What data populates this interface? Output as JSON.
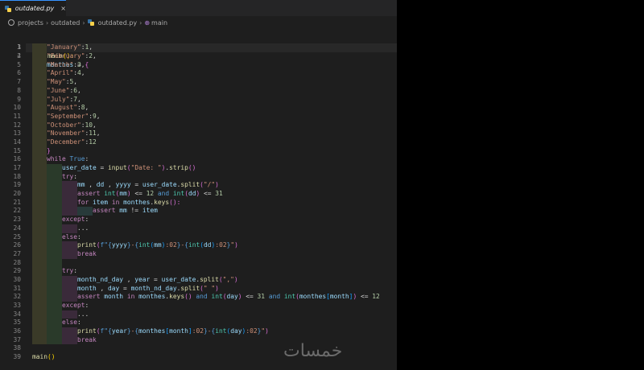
{
  "tab": {
    "filename": "outdated.py",
    "close_glyph": "×"
  },
  "breadcrumb": {
    "items": [
      "projects",
      "outdated",
      "outdated.py",
      "main"
    ],
    "separator": "›"
  },
  "line_numbers": [
    "1",
    "2",
    "3",
    "4",
    "5",
    "6",
    "7",
    "8",
    "9",
    "10",
    "11",
    "12",
    "13",
    "14",
    "15",
    "16",
    "17",
    "18",
    "19",
    "20",
    "21",
    "22",
    "23",
    "24",
    "25",
    "26",
    "27",
    "28",
    "29",
    "30",
    "31",
    "32",
    "33",
    "34",
    "35",
    "36",
    "37",
    "38",
    "39"
  ],
  "code": {
    "l1": [
      "def",
      " ",
      "main",
      "():"
    ],
    "l2": [
      "monthes",
      " = ",
      "{"
    ],
    "months": [
      [
        "\"January\"",
        ":",
        "1",
        ","
      ],
      [
        "\"February\"",
        ":",
        "2",
        ","
      ],
      [
        "\"March\"",
        ":",
        "3",
        ","
      ],
      [
        "\"April\"",
        ":",
        "4",
        ","
      ],
      [
        "\"May\"",
        ":",
        "5",
        ","
      ],
      [
        "\"June\"",
        ":",
        "6",
        ","
      ],
      [
        "\"July\"",
        ":",
        "7",
        ","
      ],
      [
        "\"August\"",
        ":",
        "8",
        ","
      ],
      [
        "\"September\"",
        ":",
        "9",
        ","
      ],
      [
        "\"October\"",
        ":",
        "10",
        ","
      ],
      [
        "\"November\"",
        ":",
        "11",
        ","
      ],
      [
        "\"December\"",
        ":",
        "12",
        ""
      ]
    ],
    "l15": "}",
    "l16": [
      "while",
      " ",
      "True",
      ":"
    ],
    "l17": [
      "user_date",
      " = ",
      "input",
      "(",
      "\"Date: \"",
      ")",
      ".",
      "strip",
      "()"
    ],
    "l18": [
      "try",
      ":"
    ],
    "l19": [
      "mm",
      " , ",
      "dd",
      " , ",
      "yyyy",
      " = ",
      "user_date",
      ".",
      "split",
      "(",
      "\"/\"",
      ")"
    ],
    "l20": [
      "assert",
      " ",
      "int",
      "(",
      "mm",
      ")",
      " <= ",
      "12",
      " ",
      "and",
      " ",
      "int",
      "(",
      "dd",
      ")",
      " <= ",
      "31"
    ],
    "l21": [
      "for",
      " ",
      "item",
      " ",
      "in",
      " ",
      "monthes",
      ".",
      "keys",
      "():"
    ],
    "l22": [
      "assert",
      " ",
      "mm",
      " != ",
      "item"
    ],
    "l23": [
      "except",
      ":"
    ],
    "l24": "...",
    "l25": [
      "else",
      ":"
    ],
    "l26": [
      "print",
      "(",
      "f\"",
      "{",
      "yyyy",
      "}",
      "-",
      "{",
      "int",
      "(",
      "mm",
      ")",
      ":02",
      "}",
      "-",
      "{",
      "int",
      "(",
      "dd",
      ")",
      ":02",
      "}",
      "\"",
      ")"
    ],
    "l27": "break",
    "l29": [
      "try",
      ":"
    ],
    "l30": [
      "month_nd_day",
      " , ",
      "year",
      " = ",
      "user_date",
      ".",
      "split",
      "(",
      "\",\"",
      ")"
    ],
    "l31": [
      "month",
      " , ",
      "day",
      " = ",
      "month_nd_day",
      ".",
      "split",
      "(",
      "\" \"",
      ")"
    ],
    "l32": [
      "assert",
      " ",
      "month",
      " ",
      "in",
      " ",
      "monthes",
      ".",
      "keys",
      "()",
      " ",
      "and",
      " ",
      "int",
      "(",
      "day",
      ")",
      " <= ",
      "31",
      " ",
      "and",
      " ",
      "int",
      "(",
      "monthes",
      "[",
      "month",
      "]",
      ")",
      " <= ",
      "12"
    ],
    "l33": [
      "except",
      ":"
    ],
    "l34": "...",
    "l35": [
      "else",
      ":"
    ],
    "l36": [
      "print",
      "(",
      "f\"",
      "{",
      "year",
      "}",
      "-",
      "{",
      "monthes",
      "[",
      "month",
      "]",
      ":02",
      "}",
      "-",
      "{",
      "int",
      "(",
      "day",
      ")",
      ":02",
      "}",
      "\"",
      ")"
    ],
    "l37": "break",
    "l39": [
      "main",
      "()"
    ]
  },
  "watermark": "خمسات"
}
